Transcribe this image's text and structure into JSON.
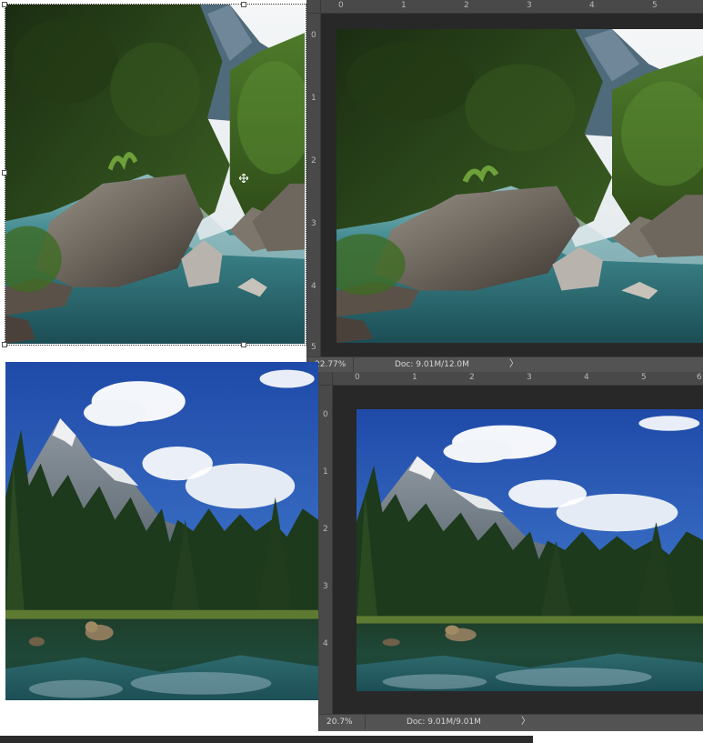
{
  "windows": [
    {
      "id": "top",
      "ruler_top": [
        "0",
        "1",
        "2",
        "3",
        "4",
        "5"
      ],
      "ruler_left": [
        "0",
        "1",
        "2",
        "3",
        "4",
        "5"
      ],
      "zoom": "22.77%",
      "doc_info": "Doc: 9.01M/12.0M",
      "arrow": "〉"
    },
    {
      "id": "bottom",
      "ruler_top": [
        "0",
        "1",
        "2",
        "3",
        "4",
        "5",
        "6"
      ],
      "ruler_left": [
        "0",
        "1",
        "2",
        "3",
        "4"
      ],
      "zoom": "20.7%",
      "doc_info": "Doc: 9.01M/9.01M",
      "arrow": "〉"
    }
  ],
  "icons": {
    "move_cursor": "move-cursor-icon",
    "status_arrow": "chevron-right-icon"
  },
  "colors": {
    "panel_bg": "#595959",
    "ruler_bg": "#494949",
    "canvas_bg": "#282828",
    "status_bg": "#535353"
  }
}
